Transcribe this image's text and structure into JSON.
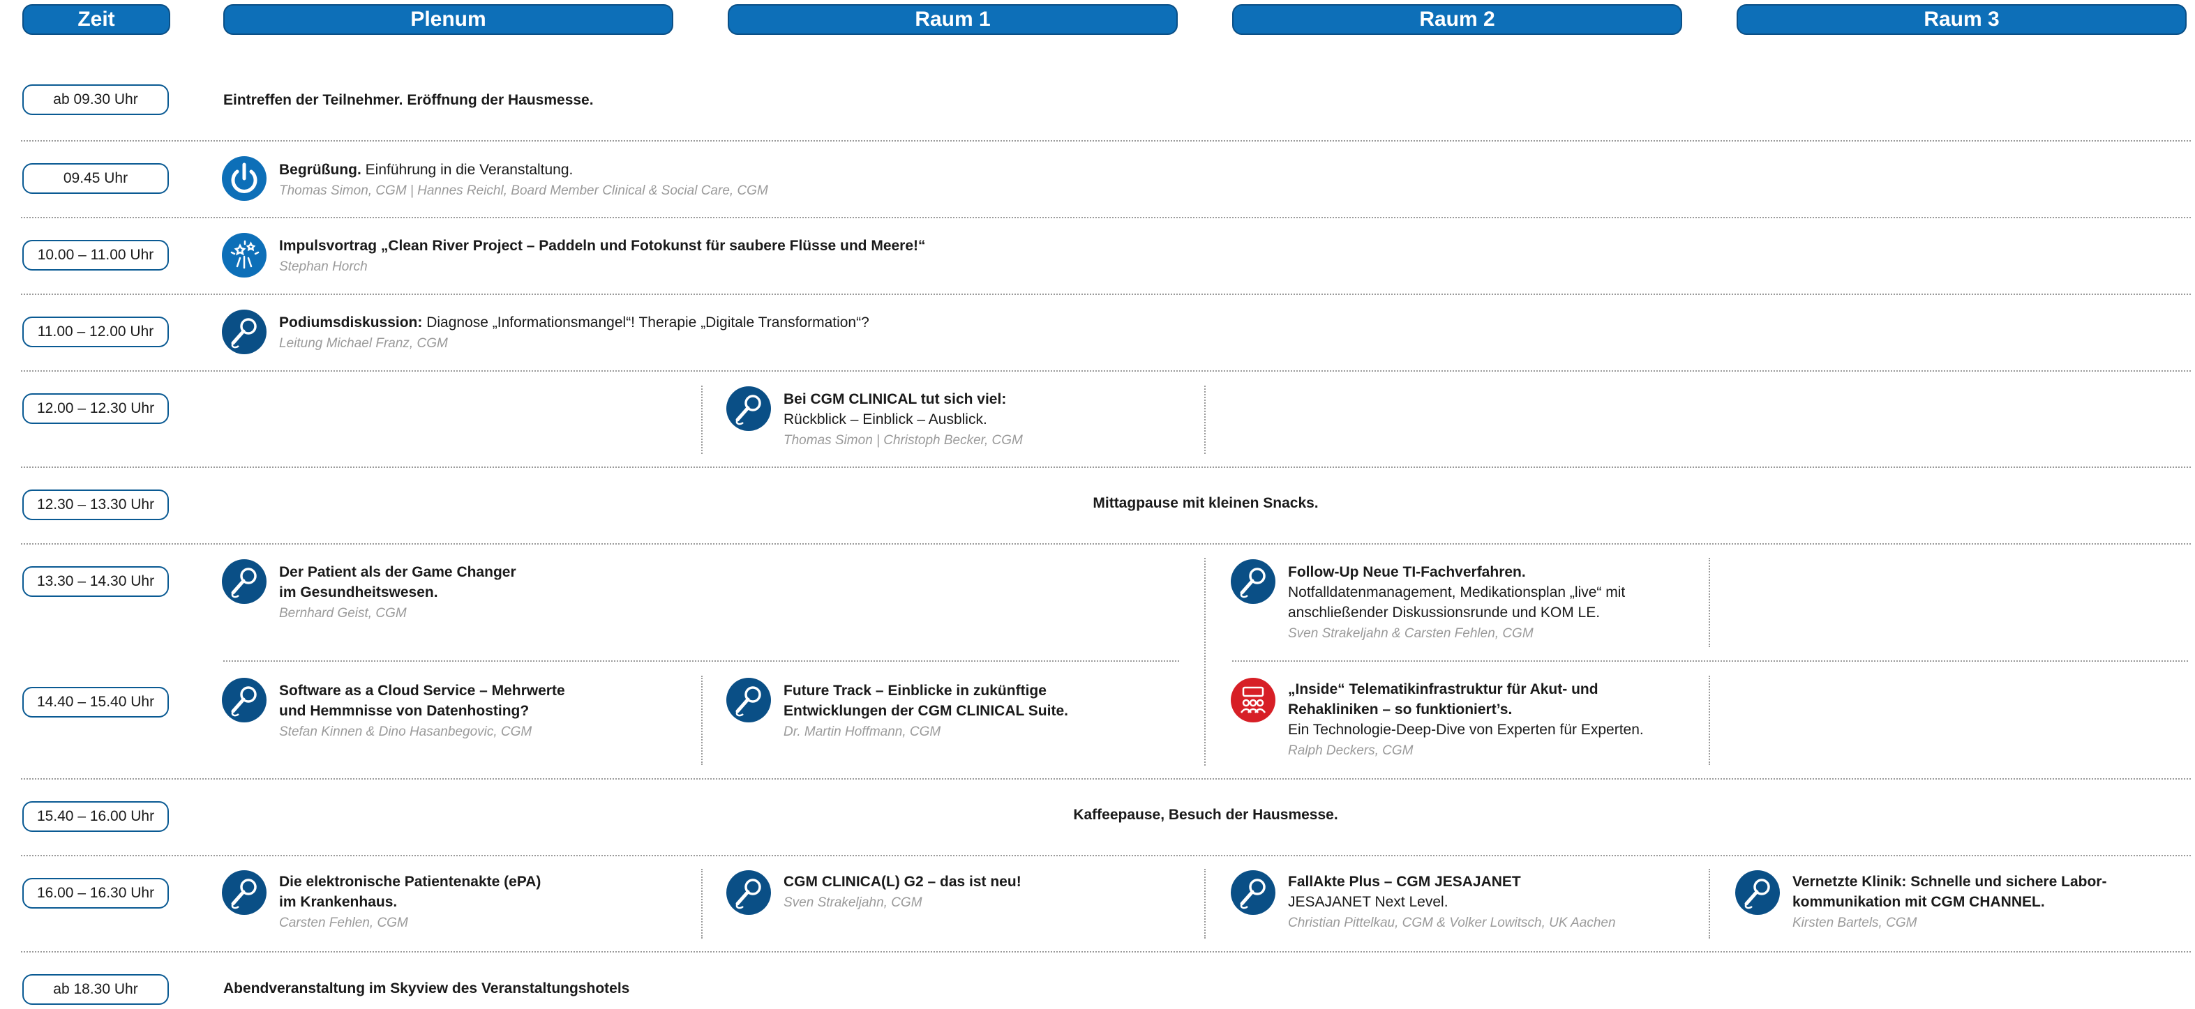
{
  "header": {
    "zeit": "Zeit",
    "plenum": "Plenum",
    "raum1": "Raum 1",
    "raum2": "Raum 2",
    "raum3": "Raum 3"
  },
  "times": [
    "ab 09.30 Uhr",
    "09.45 Uhr",
    "10.00 – 11.00 Uhr",
    "11.00 – 12.00 Uhr",
    "12.00 – 12.30 Uhr",
    "12.30 – 13.30 Uhr",
    "13.30 – 14.30 Uhr",
    "14.40 – 15.40 Uhr",
    "15.40 – 16.00 Uhr",
    "16.00 – 16.30 Uhr",
    "ab 18.30 Uhr"
  ],
  "row1": {
    "text": "Eintreffen der Teilnehmer. Eröffnung der Hausmesse."
  },
  "row2": {
    "title": "Begrüßung.",
    "desc": " Einführung in die Veranstaltung.",
    "speaker": "Thomas Simon, CGM  |  Hannes Reichl, Board Member Clinical & Social Care, CGM"
  },
  "row3": {
    "title": "Impulsvortrag „Clean River Project – Paddeln und Fotokunst für saubere Flüsse und Meere!“",
    "speaker": "Stephan Horch"
  },
  "row4": {
    "title": "Podiumsdiskussion:",
    "desc": " Diagnose „Informationsmangel“!  Therapie „Digitale Transformation“?",
    "speaker": "Leitung Michael Franz, CGM"
  },
  "row5_r1": {
    "title": "Bei CGM CLINICAL tut sich viel:",
    "desc": "Rückblick – Einblick – Ausblick.",
    "speaker": "Thomas Simon  |  Christoph Becker, CGM"
  },
  "lunch": "Mittagpause mit kleinen Snacks.",
  "row7_plenum": {
    "line1": "Der Patient als der Game Changer",
    "line2": "im Gesundheitswesen.",
    "speaker": "Bernhard Geist, CGM"
  },
  "row7_r2": {
    "title": "Follow-Up Neue TI-Fachverfahren.",
    "desc1": "Notfalldatenmanagement, Medikationsplan „live“ mit",
    "desc2": "anschließender Diskussionsrunde und KOM LE.",
    "speaker": "Sven Strakeljahn & Carsten Fehlen, CGM"
  },
  "row8_plenum": {
    "line1": "Software as a Cloud Service – Mehrwerte",
    "line2": "und Hemmnisse von Datenhosting?",
    "speaker": "Stefan Kinnen & Dino Hasanbegovic, CGM"
  },
  "row8_r1": {
    "line1": "Future Track – Einblicke in zukünftige",
    "line2": "Entwicklungen der CGM CLINICAL Suite.",
    "speaker": "Dr. Martin Hoffmann, CGM"
  },
  "row8_r2": {
    "line1": "„Inside“ Telematikinfrastruktur für Akut- und",
    "line2": "Rehakliniken – so funktioniert’s.",
    "desc": "Ein Technologie-Deep-Dive von Experten für Experten.",
    "speaker": "Ralph Deckers, CGM"
  },
  "coffee": "Kaffeepause, Besuch der Hausmesse.",
  "row10_plenum": {
    "line1": "Die elektronische Patientenakte (ePA)",
    "line2": "im Krankenhaus.",
    "speaker": "Carsten Fehlen, CGM"
  },
  "row10_r1": {
    "title": "CGM CLINICA(L) G2 – das ist neu!",
    "speaker": "Sven Strakeljahn, CGM"
  },
  "row10_r2": {
    "title": "FallAkte Plus – CGM JESAJANET",
    "desc": "JESAJANET Next Level.",
    "speaker": "Christian Pittelkau, CGM & Volker Lowitsch, UK Aachen"
  },
  "row10_r3": {
    "line1": "Vernetzte Klinik: Schnelle und sichere Labor-",
    "line2": "kommunikation mit CGM CHANNEL.",
    "speaker": "Kirsten Bartels, CGM"
  },
  "row11": {
    "text": "Abendveranstaltung im Skyview des Veranstaltungshotels"
  },
  "colors": {
    "blue": "#0d6fb8",
    "dark_blue": "#0a4f86",
    "red": "#d71f26",
    "speaker_gray": "#9a9a9a"
  }
}
